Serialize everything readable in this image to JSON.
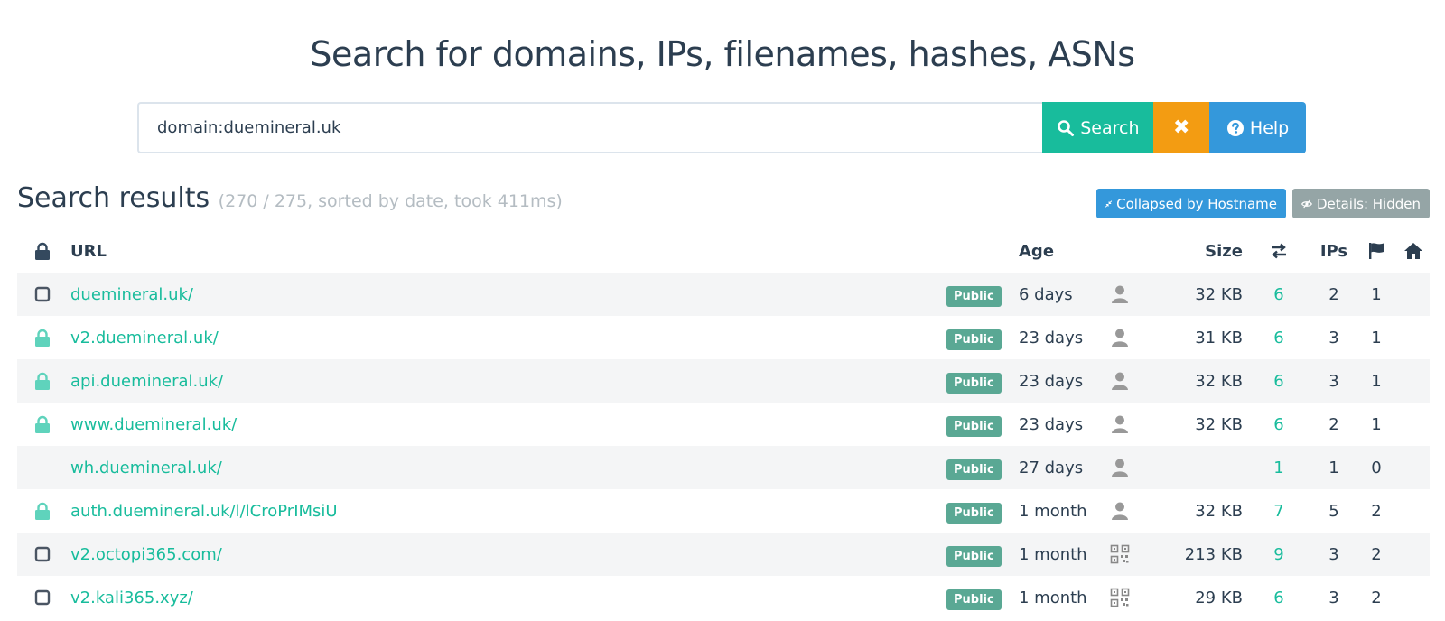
{
  "header": {
    "title": "Search for domains, IPs, filenames, hashes, ASNs"
  },
  "search": {
    "value": "domain:duemineral.uk",
    "search_label": "Search",
    "clear_label": "✖",
    "help_label": "Help"
  },
  "results": {
    "title": "Search results",
    "meta": "(270 / 275, sorted by date, took 411ms)",
    "collapse_label": "Collapsed by Hostname",
    "details_label": "Details: Hidden"
  },
  "columns": {
    "url": "URL",
    "age": "Age",
    "size": "Size",
    "ips": "IPs"
  },
  "colors": {
    "accent_green": "#18bc9c",
    "warning_orange": "#f39c12",
    "info_blue": "#3498db",
    "muted_gray": "#95a5a6",
    "badge_green": "#5aa894"
  },
  "rows": [
    {
      "icon": "checkbox-icon",
      "url": "duemineral.uk/",
      "badge": "Public",
      "age": "6 days",
      "submitter": "user-icon",
      "size": "32 KB",
      "redirects": "6",
      "ips": "2",
      "countries": "1"
    },
    {
      "icon": "lock-icon",
      "url": "v2.duemineral.uk/",
      "badge": "Public",
      "age": "23 days",
      "submitter": "user-icon",
      "size": "31 KB",
      "redirects": "6",
      "ips": "3",
      "countries": "1"
    },
    {
      "icon": "lock-icon",
      "url": "api.duemineral.uk/",
      "badge": "Public",
      "age": "23 days",
      "submitter": "user-icon",
      "size": "32 KB",
      "redirects": "6",
      "ips": "3",
      "countries": "1"
    },
    {
      "icon": "lock-icon",
      "url": "www.duemineral.uk/",
      "badge": "Public",
      "age": "23 days",
      "submitter": "user-icon",
      "size": "32 KB",
      "redirects": "6",
      "ips": "2",
      "countries": "1"
    },
    {
      "icon": "none",
      "url": "wh.duemineral.uk/",
      "badge": "Public",
      "age": "27 days",
      "submitter": "user-icon",
      "size": "",
      "redirects": "1",
      "ips": "1",
      "countries": "0"
    },
    {
      "icon": "lock-icon",
      "url": "auth.duemineral.uk/l/lCroPrIMsiU",
      "badge": "Public",
      "age": "1 month",
      "submitter": "user-icon",
      "size": "32 KB",
      "redirects": "7",
      "ips": "5",
      "countries": "2"
    },
    {
      "icon": "checkbox-icon",
      "url": "v2.octopi365.com/",
      "badge": "Public",
      "age": "1 month",
      "submitter": "qrcode-icon",
      "size": "213 KB",
      "redirects": "9",
      "ips": "3",
      "countries": "2"
    },
    {
      "icon": "checkbox-icon",
      "url": "v2.kali365.xyz/",
      "badge": "Public",
      "age": "1 month",
      "submitter": "qrcode-icon",
      "size": "29 KB",
      "redirects": "6",
      "ips": "3",
      "countries": "2"
    }
  ]
}
